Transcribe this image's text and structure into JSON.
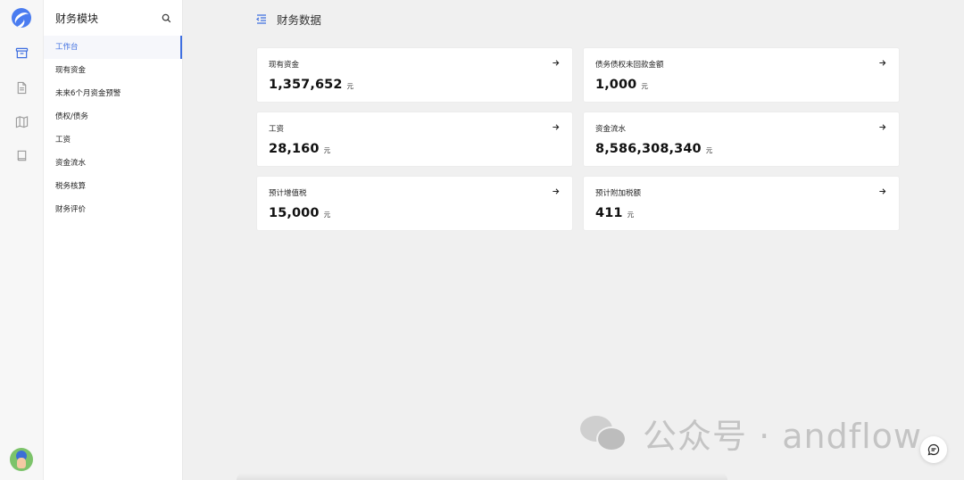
{
  "sidebar": {
    "title": "财务模块",
    "items": [
      {
        "label": "工作台",
        "active": true
      },
      {
        "label": "现有资金"
      },
      {
        "label": "未来6个月资金预警"
      },
      {
        "label": "债权/债务"
      },
      {
        "label": "工资"
      },
      {
        "label": "资金流水"
      },
      {
        "label": "税务核算"
      },
      {
        "label": "财务评价"
      }
    ]
  },
  "rail": {
    "icons": [
      "app-logo",
      "inbox-icon",
      "document-icon",
      "map-icon",
      "book-icon",
      "avatar"
    ]
  },
  "header": {
    "title": "财务数据"
  },
  "cards": [
    {
      "label": "现有资金",
      "value": "1,357,652",
      "unit": "元"
    },
    {
      "label": "债务债权未回款金额",
      "value": "1,000",
      "unit": "元"
    },
    {
      "label": "工资",
      "value": "28,160",
      "unit": "元"
    },
    {
      "label": "资金流水",
      "value": "8,586,308,340",
      "unit": "元"
    },
    {
      "label": "预计增值税",
      "value": "15,000",
      "unit": "元"
    },
    {
      "label": "预计附加税额",
      "value": "411",
      "unit": "元"
    }
  ],
  "watermark": {
    "text": "公众号 · andflow"
  },
  "colors": {
    "accent": "#3f6fe0",
    "background": "#f0f0f0",
    "card": "#ffffff"
  }
}
